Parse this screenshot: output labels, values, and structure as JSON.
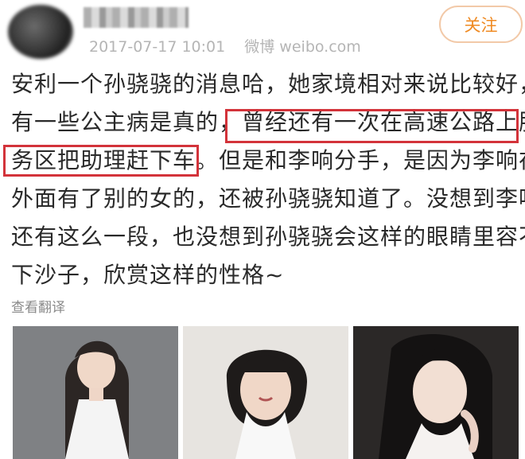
{
  "post": {
    "timestamp": "2017-07-17 10:01",
    "source": "微博 weibo.com",
    "follow_label": "关注",
    "text_lines": [
      "安利一个孙骁骁的消息哈，她家境相对来说比较好，",
      "有一些公主病是真的，曾经还有一次在高速公路上服",
      "务区把助理赶下车。但是和李响分手，是因为李响在",
      "外面有了别的女的，还被孙骁骁知道了。没想到李响",
      "还有这么一段，也没想到孙骁骁会这样的眼睛里容不",
      "下沙子，欣赏这样的性格~"
    ],
    "translate_label": "查看翻译",
    "highlight_color": "#d3333a"
  },
  "colors": {
    "follow_text": "#ef8a22",
    "follow_border": "#f2c9a8",
    "meta_text": "#b5b5b5",
    "body_text": "#2a2a2a"
  }
}
